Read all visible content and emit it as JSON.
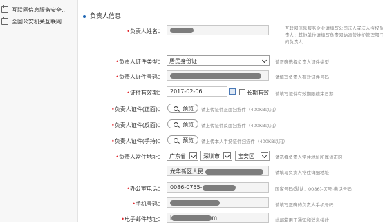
{
  "sidebar": {
    "items": [
      {
        "label": "互联网信息服务安全...",
        "icon": "document-icon"
      },
      {
        "label": "全国公安机关互联网...",
        "icon": "document-icon"
      }
    ]
  },
  "section": {
    "title": "负责人信息"
  },
  "form": {
    "name": {
      "label": "负责人姓名：",
      "hint": "互联网信息服务企业请填写公司法人或法人授权负责人；其他单位请填写负责网站运营维护管理部门的负责人"
    },
    "id_type": {
      "label": "负责人证件类型：",
      "value": "居民身份证",
      "hint": "请正确选择负责人证件类型"
    },
    "id_number": {
      "label": "负责人证件号码：",
      "hint": "请填写负责人有效证件号码"
    },
    "validity": {
      "label": "证件有效期：",
      "value": "2017-02-06",
      "long_term_label": "长期有效",
      "hint": "请填写证件有效期限结束日期"
    },
    "id_front": {
      "label": "负责人证件(正面)：",
      "button": "预览",
      "hint": "请上传证件正面扫描件（400KB以内）"
    },
    "id_back": {
      "label": "负责人证件(反面)：",
      "button": "预览",
      "hint": "请上传证件反面扫描件（400KB以内）"
    },
    "id_hand": {
      "label": "负责人证件(手持)：",
      "button": "预览",
      "hint": "请上传本人手持证件扫描件（400KB以内）"
    },
    "address": {
      "label": "负责人常住地址：",
      "province": "广东省",
      "city": "深圳市",
      "district": "宝安区",
      "hint": "请选择负责人常住地址所属省市区",
      "detail_value": "龙华新区人民",
      "detail_hint": "请填写负责人常住详细地址"
    },
    "office_phone": {
      "label": "办公室电话：",
      "value": "0086-0755-",
      "hint": "国家号码(默认：0086)-区号-电话号码"
    },
    "mobile": {
      "label": "手机号码：",
      "hint": "请填写正确的负责人手机号码"
    },
    "email": {
      "label": "电子邮件地址：",
      "value_start": "l",
      "value_end": "m",
      "hint": "此邮箱用于通知和消息接收"
    }
  }
}
